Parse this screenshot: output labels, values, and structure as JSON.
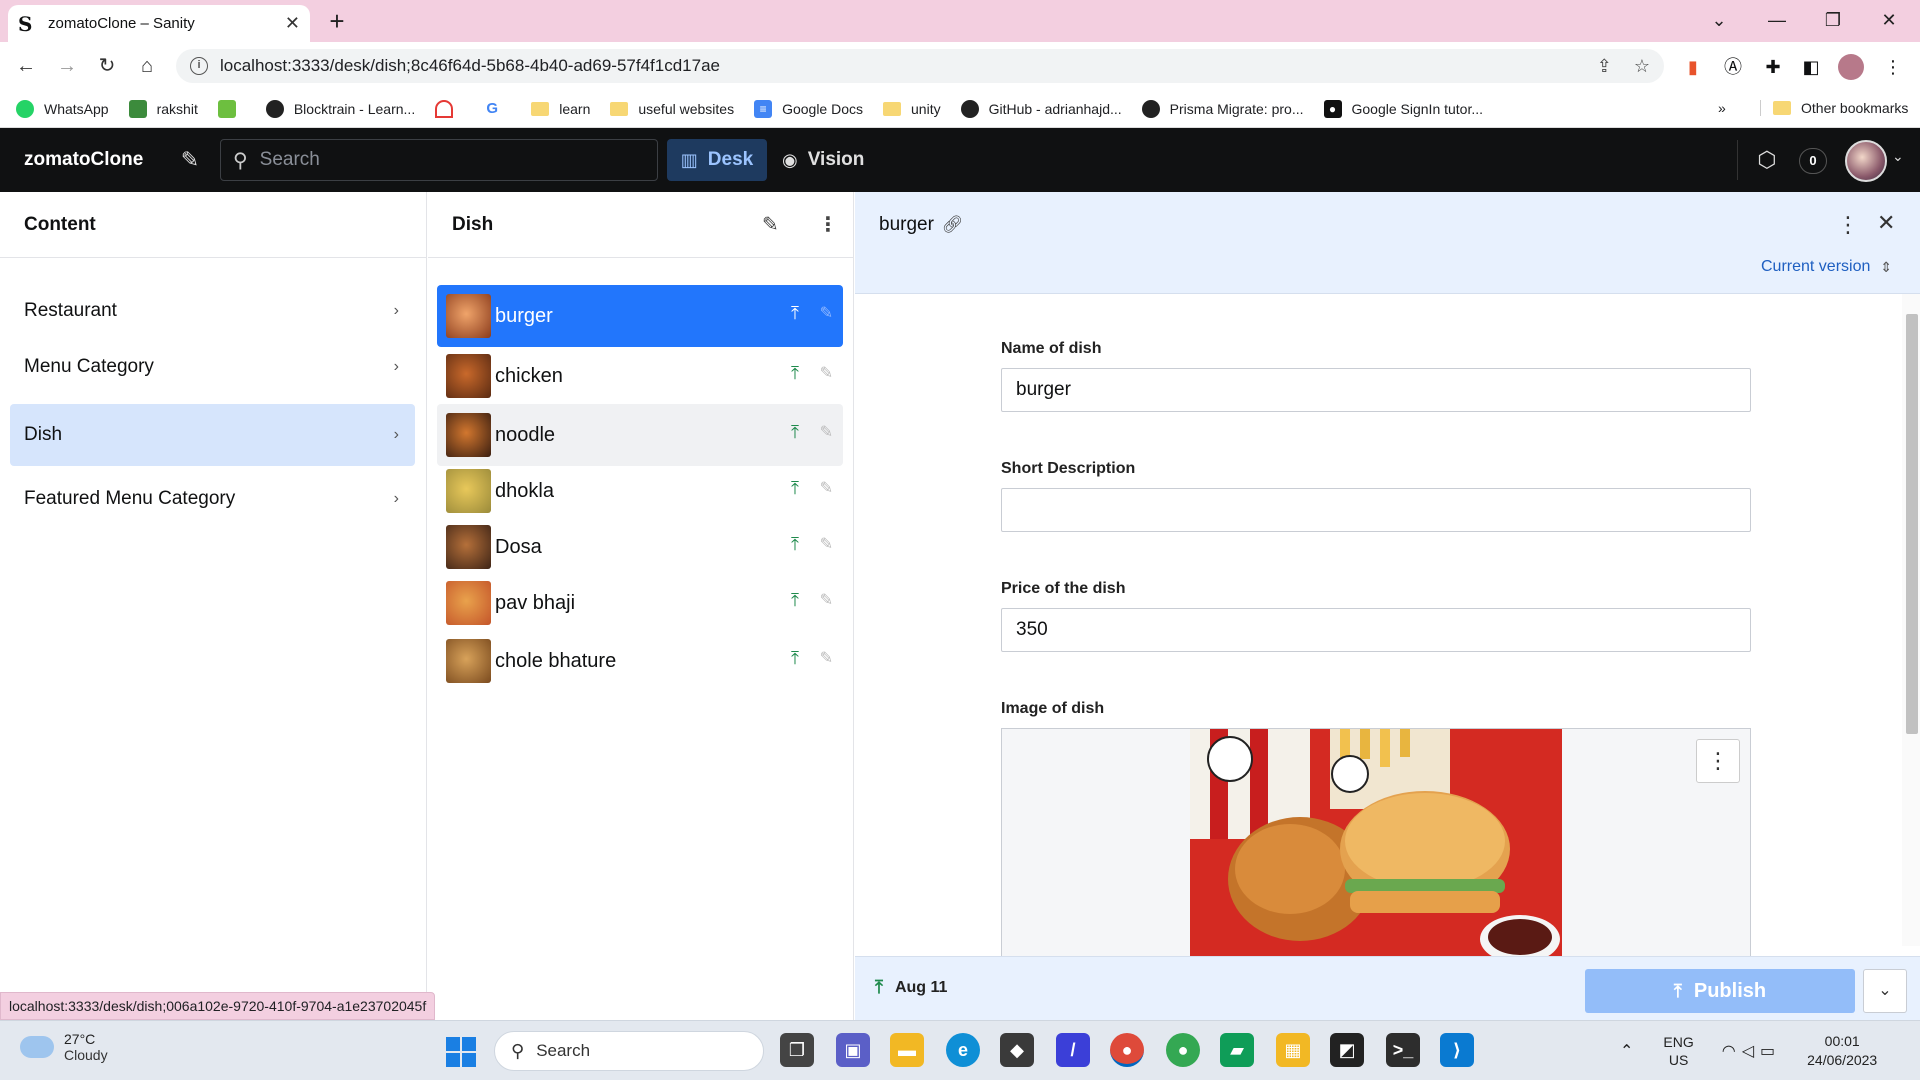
{
  "browser": {
    "tab_title": "zomatoClone – Sanity",
    "tab_favicon": "S",
    "url": "localhost:3333/desk/dish;8c46f64d-5b68-4b40-ad69-57f4f1cd17ae",
    "bookmarks": [
      {
        "label": "WhatsApp",
        "icon": "whatsapp-icon",
        "color": "#25d366"
      },
      {
        "label": "rakshit",
        "icon": "app-icon",
        "color": "#3c8b3c"
      },
      {
        "label": "",
        "icon": "download-icon",
        "color": "#4caf50"
      },
      {
        "label": "Blocktrain - Learn...",
        "icon": "globe-icon",
        "color": "#222222"
      },
      {
        "label": "",
        "icon": "gauge-icon",
        "color": "#e53935"
      },
      {
        "label": "",
        "icon": "google-icon",
        "color": "#4285f4"
      },
      {
        "label": "learn",
        "icon": "folder-icon",
        "color": "#f7d774"
      },
      {
        "label": "useful websites",
        "icon": "folder-icon",
        "color": "#f7d774"
      },
      {
        "label": "Google Docs",
        "icon": "docs-icon",
        "color": "#4285f4"
      },
      {
        "label": "unity",
        "icon": "folder-icon",
        "color": "#f7d774"
      },
      {
        "label": "GitHub - adrianhajd...",
        "icon": "github-icon",
        "color": "#222222"
      },
      {
        "label": "Prisma Migrate: pro...",
        "icon": "github-icon",
        "color": "#222222"
      },
      {
        "label": "Google SignIn tutor...",
        "icon": "medium-icon",
        "color": "#111111"
      }
    ],
    "bookmarks_overflow": "»",
    "other_bookmarks": "Other bookmarks",
    "status_url": "localhost:3333/desk/dish;006a102e-9720-410f-9704-a1e23702045f"
  },
  "studio": {
    "brand": "zomatoClone",
    "search_placeholder": "Search",
    "tool_desk": "Desk",
    "tool_vision": "Vision",
    "notification_count": "0"
  },
  "content_pane": {
    "title": "Content",
    "items": [
      {
        "label": "Restaurant",
        "selected": false
      },
      {
        "label": "Menu Category",
        "selected": false
      },
      {
        "label": "Dish",
        "selected": true
      },
      {
        "label": "Featured Menu Category",
        "selected": false
      }
    ]
  },
  "dish_pane": {
    "title": "Dish",
    "items": [
      {
        "label": "burger",
        "state": "selected",
        "thumb": [
          "#f0a46a",
          "#8a3b1c"
        ]
      },
      {
        "label": "chicken",
        "state": "",
        "thumb": [
          "#c9692b",
          "#5a2a12"
        ]
      },
      {
        "label": "noodle",
        "state": "hover",
        "thumb": [
          "#d2772f",
          "#3a1e10"
        ]
      },
      {
        "label": "dhokla",
        "state": "",
        "thumb": [
          "#e8c85a",
          "#9a8a3a"
        ]
      },
      {
        "label": "Dosa",
        "state": "",
        "thumb": [
          "#b5703a",
          "#3e2416"
        ]
      },
      {
        "label": "pav bhaji",
        "state": "",
        "thumb": [
          "#e9a24c",
          "#c4552a"
        ]
      },
      {
        "label": "chole bhature",
        "state": "",
        "thumb": [
          "#d8a25a",
          "#7a4a1e"
        ]
      }
    ]
  },
  "document": {
    "title": "burger",
    "version_label": "Current version",
    "fields": {
      "name_label": "Name of dish",
      "name_value": "burger",
      "desc_label": "Short Description",
      "desc_value": "",
      "price_label": "Price of the dish",
      "price_value": "350",
      "image_label": "Image of dish"
    },
    "footer": {
      "last_published": "Aug 11",
      "publish_label": "Publish"
    }
  },
  "taskbar": {
    "temperature": "27°C",
    "weather": "Cloudy",
    "search_label": "Search",
    "lang_top": "ENG",
    "lang_bottom": "US",
    "time": "00:01",
    "date": "24/06/2023"
  }
}
